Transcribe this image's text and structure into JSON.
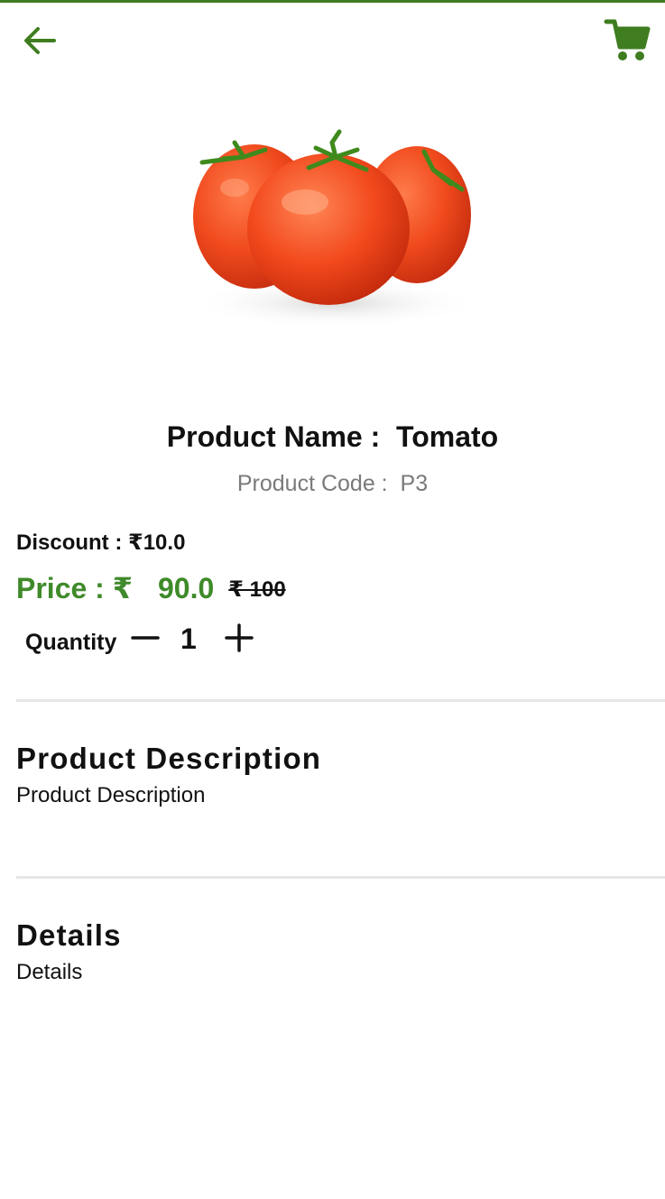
{
  "header": {
    "back_icon": "arrow-left-icon",
    "cart_icon": "shopping-cart-icon",
    "accent_color": "#3f7d20"
  },
  "product": {
    "image_icon": "tomato-image",
    "name_label": "Product Name :",
    "name_value": "Tomato",
    "code_label": "Product Code :",
    "code_value": "P3",
    "discount_label": "Discount :",
    "discount_value": "₹10.0",
    "price_label": "Price : ₹",
    "price_value": "90.0",
    "mrp": "₹ 100",
    "price_color": "#3f8a2a"
  },
  "quantity": {
    "label": "Quantity",
    "minus_icon": "minus-icon",
    "value": "1",
    "plus_icon": "plus-icon"
  },
  "sections": [
    {
      "title": "Product Description",
      "body": "Product Description"
    },
    {
      "title": "Details",
      "body": "Details"
    }
  ]
}
